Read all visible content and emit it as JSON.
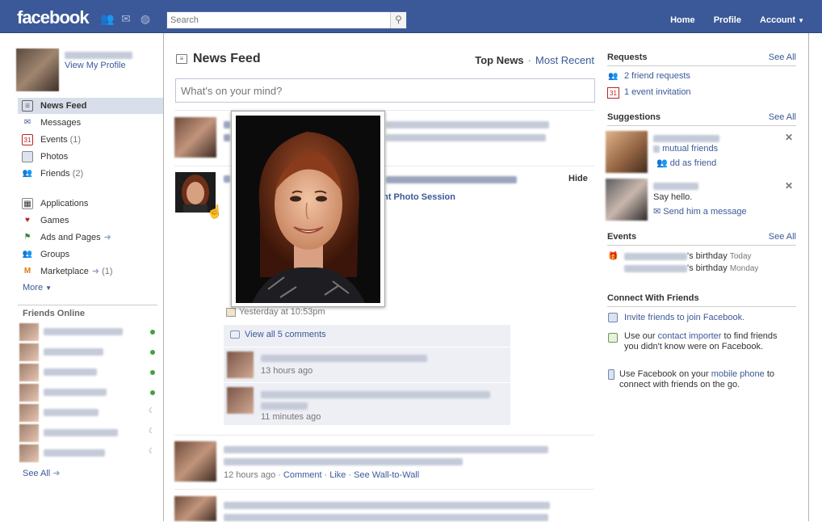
{
  "topbar": {
    "logo": "facebook",
    "search_placeholder": "Search",
    "nav": [
      "Home",
      "Profile",
      "Account"
    ]
  },
  "left": {
    "view_profile": "View My Profile",
    "nav": [
      {
        "label": "News Feed",
        "icon": "news-feed-icon",
        "count": "",
        "selected": true
      },
      {
        "label": "Messages",
        "icon": "messages-icon",
        "count": ""
      },
      {
        "label": "Events",
        "icon": "events-icon",
        "count": "(1)"
      },
      {
        "label": "Photos",
        "icon": "photos-icon",
        "count": ""
      },
      {
        "label": "Friends",
        "icon": "friends-icon",
        "count": "(2)"
      }
    ],
    "apps": [
      {
        "label": "Applications",
        "icon": "applications-icon",
        "count": ""
      },
      {
        "label": "Games",
        "icon": "games-icon",
        "count": ""
      },
      {
        "label": "Ads and Pages",
        "icon": "ads-icon",
        "count": ""
      },
      {
        "label": "Groups",
        "icon": "groups-icon",
        "count": ""
      },
      {
        "label": "Marketplace",
        "icon": "marketplace-icon",
        "count": "(1)"
      }
    ],
    "more": "More",
    "friends_online_title": "Friends Online",
    "see_all": "See All"
  },
  "center": {
    "title": "News Feed",
    "filter_top": "Top News",
    "filter_sep": "·",
    "filter_recent": "Most Recent",
    "composer_placeholder": "What's on your mind?",
    "hide": "Hide",
    "photo_session": "ent Photo Session",
    "timestamp": "Yesterday at 10:53pm",
    "view_comments": "View all 5 comments",
    "comment_times": [
      "13 hours ago",
      "11 minutes ago"
    ],
    "story_actions": {
      "time": "12 hours ago",
      "comment": "Comment",
      "like": "Like",
      "wall": "See Wall-to-Wall",
      "sep": "·"
    }
  },
  "right": {
    "requests_title": "Requests",
    "see_all": "See All",
    "friend_requests": "2 friend requests",
    "event_invitation": "1 event invitation",
    "suggestions_title": "Suggestions",
    "mutual_friends": "mutual friends",
    "add_as_friend": "dd as friend",
    "say_hello": "Say hello.",
    "send_message": "Send him a message",
    "events_title": "Events",
    "birthday_1": "'s birthday",
    "birthday_1_when": "Today",
    "birthday_2": "'s birthday",
    "birthday_2_when": "Monday",
    "connect_title": "Connect With Friends",
    "invite": "Invite friends to join Facebook.",
    "importer_pre": "Use our ",
    "importer_link": "contact importer",
    "importer_post": " to find friends you didn't know were on Facebook.",
    "mobile_pre": "Use Facebook on your ",
    "mobile_link": "mobile phone",
    "mobile_post": " to connect with friends on the go."
  }
}
